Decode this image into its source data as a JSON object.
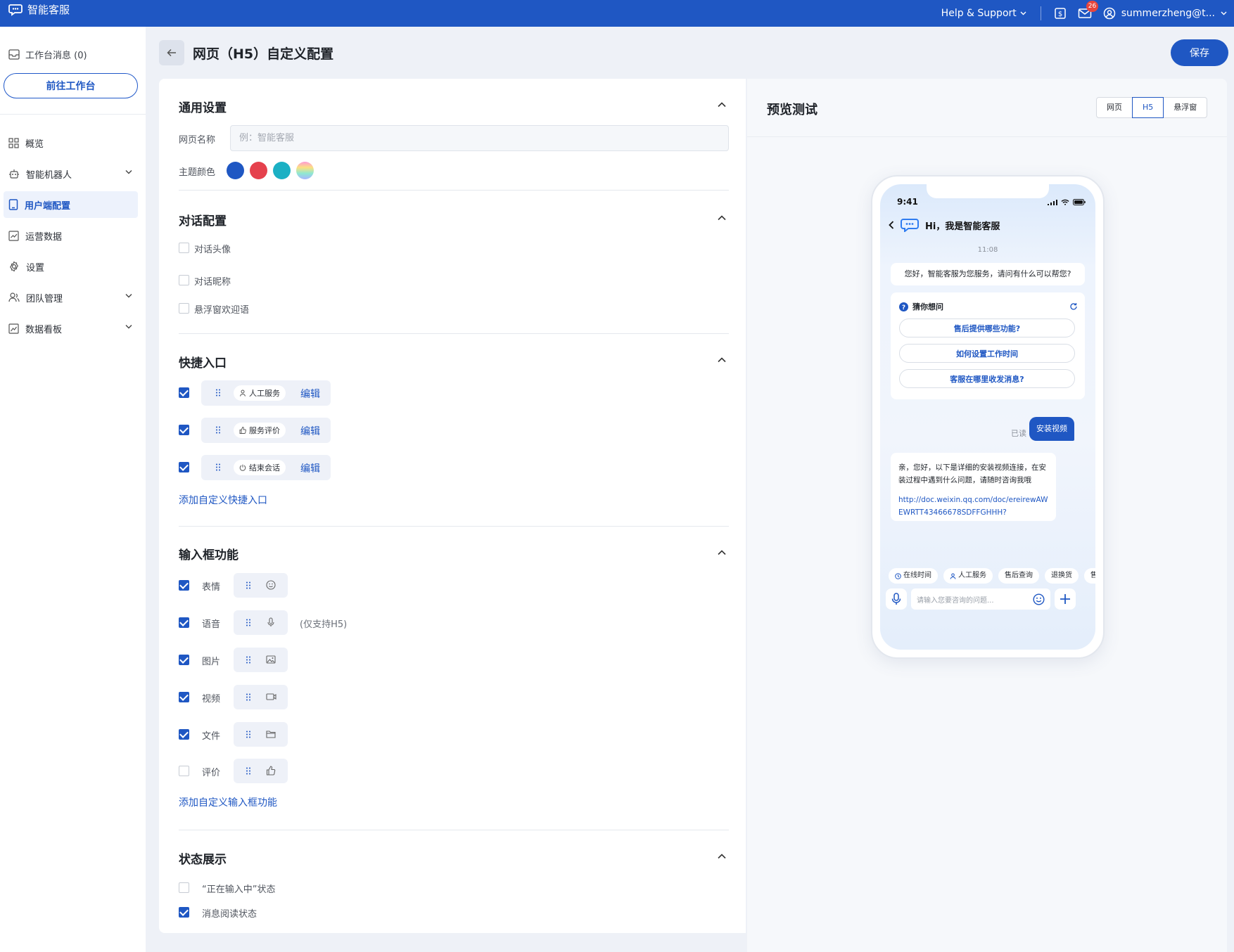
{
  "app": {
    "title": "智能客服"
  },
  "topbar": {
    "help": "Help & Support",
    "mail_badge": "26",
    "user": "summerzheng@t..."
  },
  "sidebar": {
    "messages": "工作台消息 (0)",
    "goto_button": "前往工作台",
    "items": [
      {
        "label": "概览",
        "icon": "grid-icon"
      },
      {
        "label": "智能机器人",
        "icon": "robot-icon"
      },
      {
        "label": "用户端配置",
        "icon": "tablet-icon",
        "active": true
      },
      {
        "label": "运营数据",
        "icon": "chart-icon"
      },
      {
        "label": "设置",
        "icon": "gear-icon"
      },
      {
        "label": "团队管理",
        "icon": "team-icon"
      },
      {
        "label": "数据看板",
        "icon": "dashboard-icon"
      }
    ]
  },
  "page": {
    "title": "网页（H5）自定义配置",
    "save": "保存"
  },
  "general": {
    "title": "通用设置",
    "name_label": "网页名称",
    "name_placeholder": "例：智能客服",
    "theme_label": "主题颜色",
    "theme_colors": [
      "#1f57c3",
      "#e5414d",
      "#1bb0c4",
      "rainbow"
    ]
  },
  "dialog": {
    "title": "对话配置",
    "options": [
      {
        "label": "对话头像",
        "checked": false
      },
      {
        "label": "对话昵称",
        "checked": false
      },
      {
        "label": "悬浮窗欢迎语",
        "checked": false
      }
    ]
  },
  "quick": {
    "title": "快捷入口",
    "items": [
      {
        "label": "人工服务",
        "icon": "person-icon",
        "checked": true
      },
      {
        "label": "服务评价",
        "icon": "thumb-up-icon",
        "checked": true
      },
      {
        "label": "结束会话",
        "icon": "power-icon",
        "checked": true
      }
    ],
    "edit_label": "编辑",
    "add_link": "添加自定义快捷入口"
  },
  "inputbox": {
    "title": "输入框功能",
    "items": [
      {
        "label": "表情",
        "icon": "smile-icon",
        "checked": true
      },
      {
        "label": "语音",
        "icon": "mic-icon",
        "checked": true,
        "note": "(仅支持H5)"
      },
      {
        "label": "图片",
        "icon": "image-icon",
        "checked": true
      },
      {
        "label": "视频",
        "icon": "video-icon",
        "checked": true
      },
      {
        "label": "文件",
        "icon": "folder-icon",
        "checked": true
      },
      {
        "label": "评价",
        "icon": "thumb-up-icon",
        "checked": false
      }
    ],
    "add_link": "添加自定义输入框功能"
  },
  "status": {
    "title": "状态展示",
    "options": [
      {
        "label": "“正在输入中”状态",
        "checked": false
      },
      {
        "label": "消息阅读状态",
        "checked": true
      }
    ]
  },
  "preview": {
    "title": "预览测试",
    "tabs": [
      {
        "label": "网页"
      },
      {
        "label": "H5",
        "active": true
      },
      {
        "label": "悬浮窗"
      }
    ],
    "phone": {
      "time": "9:41",
      "header": "Hi，我是智能客服",
      "timestamp": "11:08",
      "greeting": "您好，智能客服为您服务，请问有什么可以帮您?",
      "guess_title": "猜你想问",
      "questions": [
        "售后提供哪些功能?",
        "如何设置工作时间",
        "客服在哪里收发消息?"
      ],
      "read": "已读",
      "user_msg": "安装视频",
      "reply": "亲，您好，以下是详细的安装视频连接，在安装过程中遇到什么问题，请随时咨询我哦",
      "reply_url": "http://doc.weixin.qq.com/doc/ereirewAWEWRTT43466678SDFFGHHH?",
      "quick_chips": [
        "在线时间",
        "人工服务",
        "售后查询",
        "退换货",
        "售"
      ],
      "input_placeholder": "请输入您要咨询的问题..."
    }
  }
}
